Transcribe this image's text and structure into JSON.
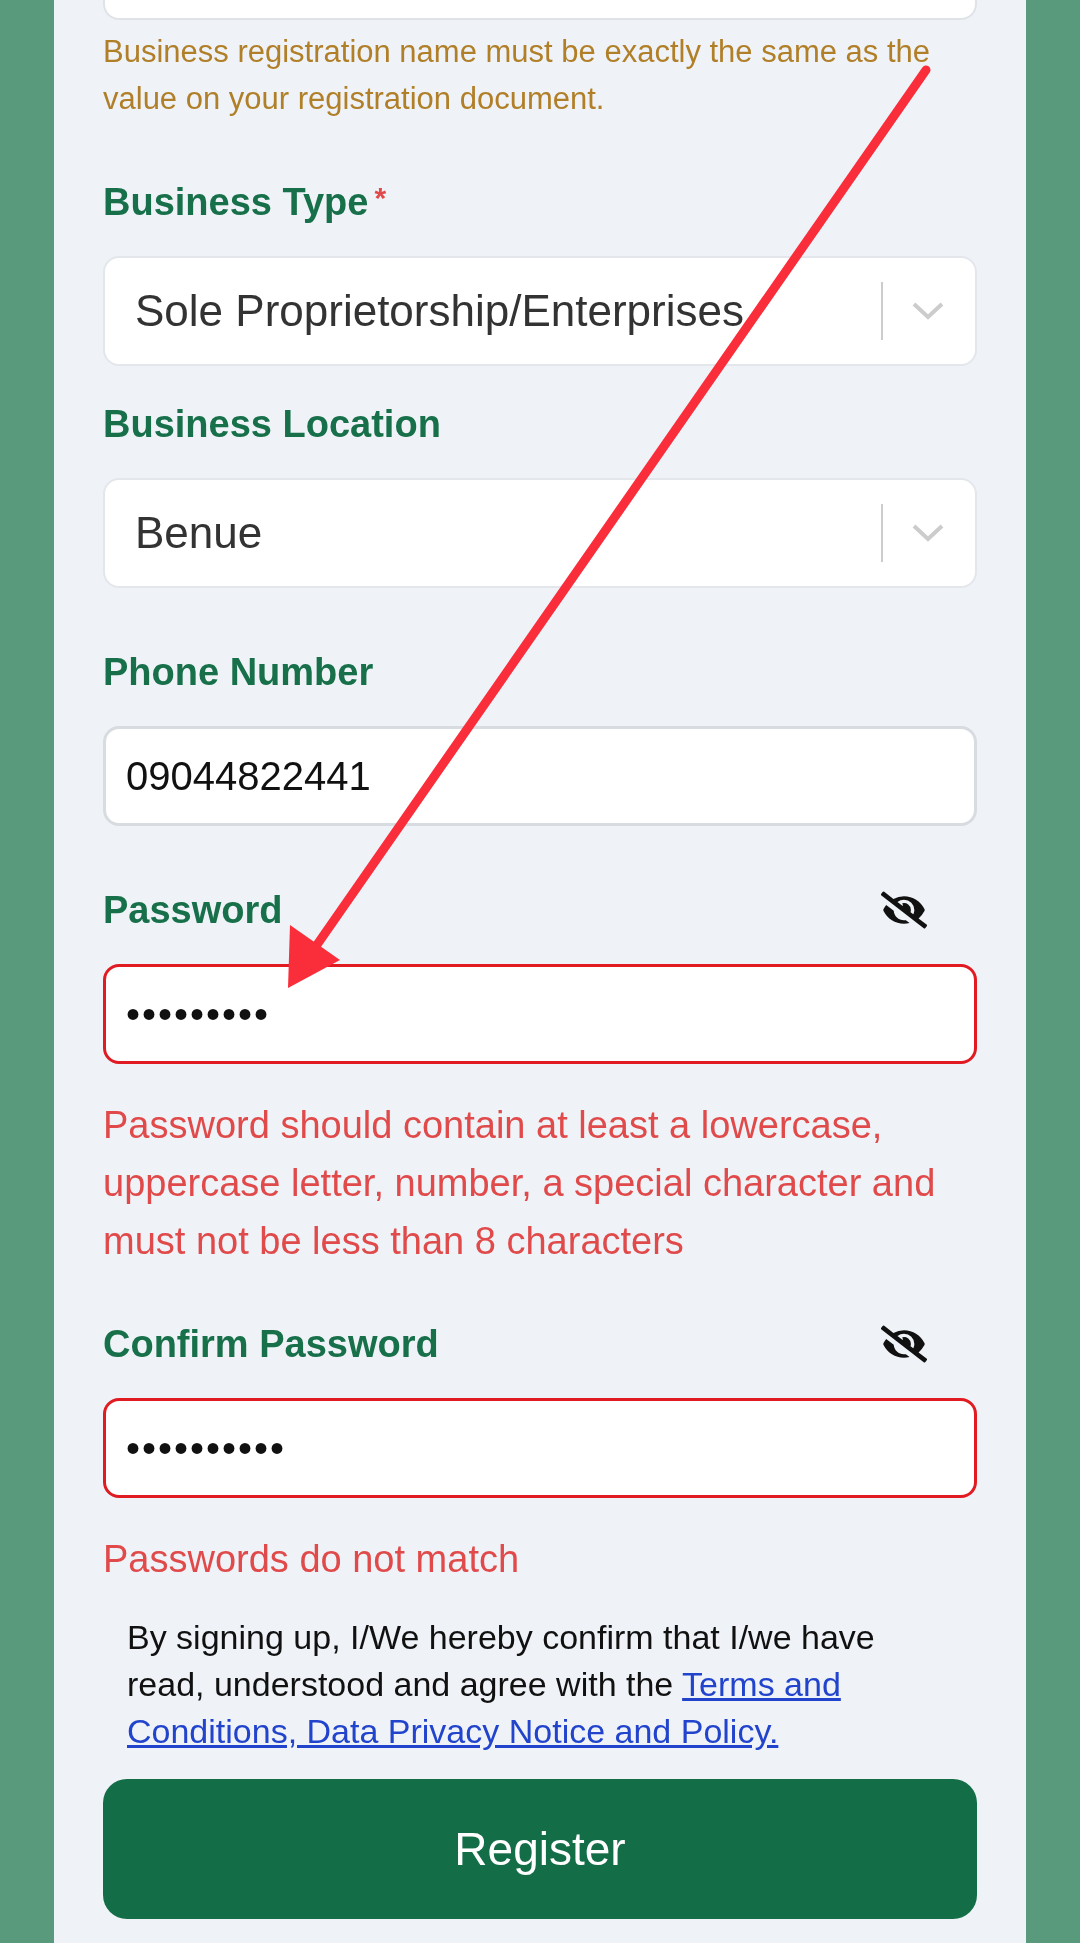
{
  "top_hint": "Business registration name must be exactly the same as the value on your registration document.",
  "fields": [
    {
      "kind": "select",
      "label": "Business Type",
      "required_mark": "*",
      "value": "Sole Proprietorship/Enterprises",
      "error": false
    },
    {
      "kind": "select",
      "label": "Business Location",
      "value": "Benue",
      "error": false
    },
    {
      "kind": "text",
      "label": "Phone Number",
      "value": "09044822441",
      "error": false
    },
    {
      "kind": "password",
      "label": "Password",
      "value": "•••••••••",
      "error": true,
      "error_text": "Password should contain at least a lowercase, uppercase letter, number, a special character and must not be less than 8 characters"
    },
    {
      "kind": "password",
      "label": "Confirm Password",
      "value": "••••••••••",
      "error": true,
      "error_text": "Passwords do not match"
    }
  ],
  "consent": {
    "text": "By signing up, I/We hereby confirm that I/we have read, understood and agree with the ",
    "link": [
      "Terms and",
      "Conditions, Data Privacy Notice and Policy."
    ]
  },
  "register_button": "Register"
}
